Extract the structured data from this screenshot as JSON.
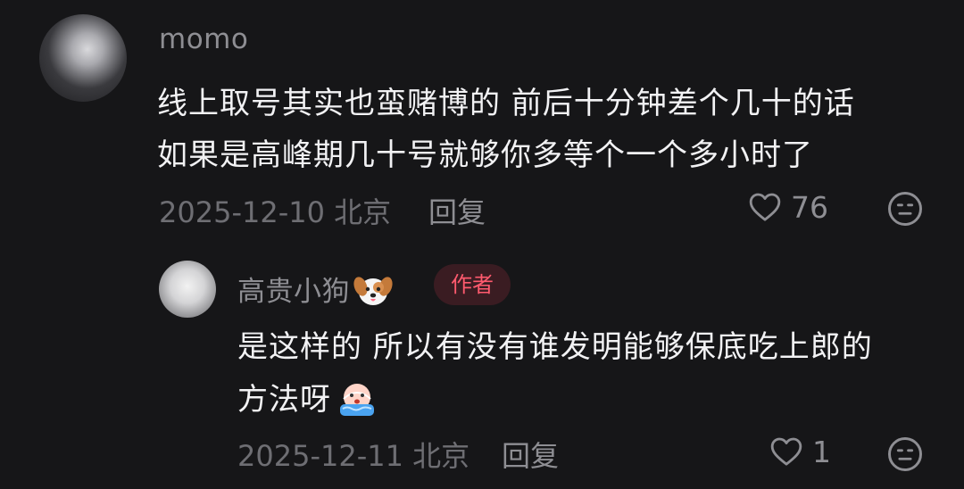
{
  "comments": [
    {
      "username": "momo",
      "text_lines": [
        "线上取号其实也蛮赌博的 前后十分钟差个几十的话",
        "如果是高峰期几十号就够你多等个一个多小时了"
      ],
      "date": "2025-12-10",
      "location": "北京",
      "reply_label": "回复",
      "like_count": "76",
      "icons": {
        "avatar": "avatar",
        "like": "heart-outline-icon",
        "dislike": "neutral-face-icon"
      }
    },
    {
      "username": "高贵小狗",
      "username_emoji": "dog-face-icon",
      "badge": "作者",
      "text_lines": [
        "是这样的 所以有没有谁发明能够保底吃上郎的",
        "方法呀"
      ],
      "text_emoji": "crying-face-icon",
      "date": "2025-12-11",
      "location": "北京",
      "reply_label": "回复",
      "like_count": "1",
      "icons": {
        "avatar": "avatar",
        "like": "heart-outline-icon",
        "dislike": "neutral-face-icon"
      }
    }
  ],
  "colors": {
    "background": "#161618",
    "primary_text": "#f2f2f4",
    "secondary_text": "#8e8e93",
    "badge_text": "#ff5a6e",
    "badge_bg": "#3a1c22"
  }
}
